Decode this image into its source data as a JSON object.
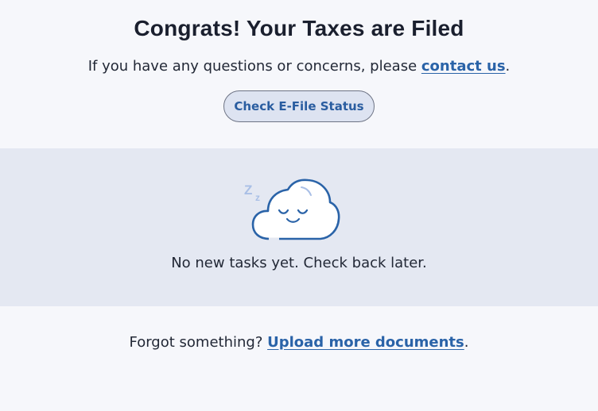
{
  "header": {
    "title": "Congrats! Your Taxes are Filed",
    "subtitle_prefix": "If you have any questions or concerns, please ",
    "contact_link": "contact us",
    "subtitle_suffix": "."
  },
  "actions": {
    "efile_status_button": "Check E-File Status"
  },
  "tasks": {
    "empty_icon": "sleeping-cloud-icon",
    "empty_message": "No new tasks yet. Check back later."
  },
  "footer": {
    "prefix": "Forgot something? ",
    "upload_link": "Upload more documents",
    "suffix": "."
  },
  "colors": {
    "accent": "#2a63a8",
    "button_bg": "#dde3f1",
    "panel_bg": "#e4e8f2",
    "page_bg": "#f6f7fb"
  }
}
